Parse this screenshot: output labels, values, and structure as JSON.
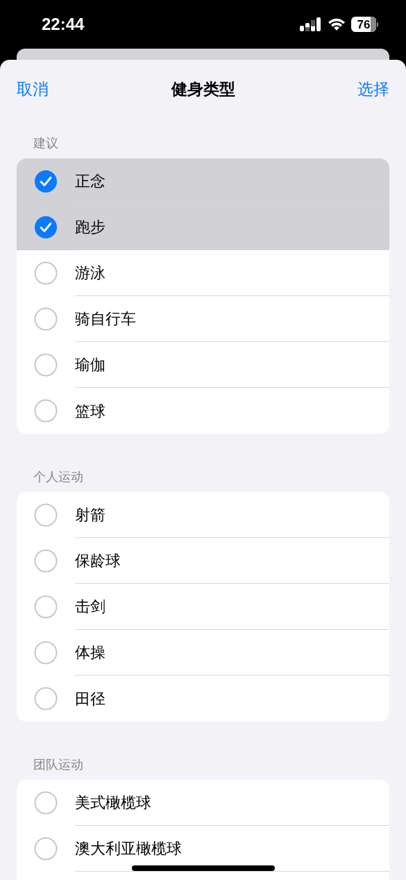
{
  "status_bar": {
    "time": "22:44",
    "battery": "76"
  },
  "nav": {
    "cancel": "取消",
    "title": "健身类型",
    "confirm": "选择"
  },
  "sections": [
    {
      "header": "建议",
      "items": [
        {
          "label": "正念",
          "checked": true
        },
        {
          "label": "跑步",
          "checked": true
        },
        {
          "label": "游泳",
          "checked": false
        },
        {
          "label": "骑自行车",
          "checked": false
        },
        {
          "label": "瑜伽",
          "checked": false
        },
        {
          "label": "篮球",
          "checked": false
        }
      ]
    },
    {
      "header": "个人运动",
      "items": [
        {
          "label": "射箭",
          "checked": false
        },
        {
          "label": "保龄球",
          "checked": false
        },
        {
          "label": "击剑",
          "checked": false
        },
        {
          "label": "体操",
          "checked": false
        },
        {
          "label": "田径",
          "checked": false
        }
      ]
    },
    {
      "header": "团队运动",
      "items": [
        {
          "label": "美式橄榄球",
          "checked": false
        },
        {
          "label": "澳大利亚橄榄球",
          "checked": false
        }
      ]
    }
  ]
}
